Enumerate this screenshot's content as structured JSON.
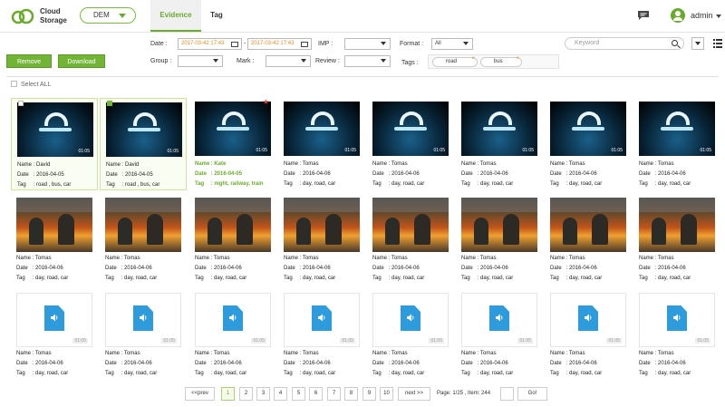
{
  "header": {
    "logo_line1": "Cloud",
    "logo_line2": "Storage",
    "dem_select": "DEM",
    "tabs": [
      {
        "label": "Evidence"
      },
      {
        "label": "Tag"
      }
    ],
    "user": "admin"
  },
  "filters": {
    "date_label": "Date :",
    "date_from": "2017-03-42  17:43",
    "date_to": "2017-03-42  17:43",
    "imp_label": "IMP :",
    "format_label": "Format :",
    "format_value": "All",
    "keyword_placeholder": "Keyword",
    "group_label": "Group :",
    "mark_label": "Mark :",
    "review_label": "Review :",
    "tags_label": "Tags :",
    "tags": [
      "road",
      "bus"
    ]
  },
  "actions": {
    "remove": "Remove",
    "download": "Download",
    "select_all": "Select ALL"
  },
  "labels": {
    "name": "Name",
    "date": "Date",
    "tag": "Tag"
  },
  "cards": [
    {
      "type": "night",
      "duration": "01:05",
      "name": "David",
      "date": "2016-04-05",
      "tag": "road , bus, car",
      "selected": true,
      "checked": false
    },
    {
      "type": "night",
      "duration": "01:05",
      "name": "David",
      "date": "2016-04-05",
      "tag": "road , bus, car",
      "selected": true,
      "checked": true
    },
    {
      "type": "night",
      "duration": "01:05",
      "name": "Kate",
      "date": "2016-04-05",
      "tag": "night, railway, train",
      "highlight": true,
      "starred": true
    },
    {
      "type": "night",
      "duration": "01:05",
      "name": "Tomas",
      "date": "2016-04-06",
      "tag": "day, road, car"
    },
    {
      "type": "night",
      "duration": "01:05",
      "name": "Tomas",
      "date": "2016-04-06",
      "tag": "day, road, car"
    },
    {
      "type": "night",
      "duration": "01:05",
      "name": "Tomas",
      "date": "2016-04-06",
      "tag": "day, road, car"
    },
    {
      "type": "night",
      "duration": "01:05",
      "name": "Tomas",
      "date": "2016-04-06",
      "tag": "day, road, car"
    },
    {
      "type": "night",
      "duration": "01:05",
      "name": "Tomas",
      "date": "2016-04-06",
      "tag": "day, road, car"
    },
    {
      "type": "fire",
      "duration": "",
      "name": "Tomas",
      "date": "2016-04-06",
      "tag": "day, road, car"
    },
    {
      "type": "fire",
      "duration": "",
      "name": "Tomas",
      "date": "2016-04-06",
      "tag": "day, road, car"
    },
    {
      "type": "fire",
      "duration": "",
      "name": "Tomas",
      "date": "2016-04-06",
      "tag": "day, road, car"
    },
    {
      "type": "fire",
      "duration": "",
      "name": "Tomas",
      "date": "2016-04-06",
      "tag": "day, road, car"
    },
    {
      "type": "fire",
      "duration": "",
      "name": "Tomas",
      "date": "2016-04-06",
      "tag": "day, road, car"
    },
    {
      "type": "fire",
      "duration": "",
      "name": "Tomas",
      "date": "2016-04-06",
      "tag": "day, road, car"
    },
    {
      "type": "fire",
      "duration": "",
      "name": "Tomas",
      "date": "2016-04-06",
      "tag": "day, road, car"
    },
    {
      "type": "fire",
      "duration": "",
      "name": "Tomas",
      "date": "2016-04-06",
      "tag": "day, road, car"
    },
    {
      "type": "audio",
      "duration": "01:05",
      "name": "Tomas",
      "date": "2016-04-06",
      "tag": "day, road, car"
    },
    {
      "type": "audio",
      "duration": "01:05",
      "name": "Tomas",
      "date": "2016-04-06",
      "tag": "day, road, car"
    },
    {
      "type": "audio",
      "duration": "01:05",
      "name": "Tomas",
      "date": "2016-04-06",
      "tag": "day, road, car"
    },
    {
      "type": "audio",
      "duration": "01:05",
      "name": "Tomas",
      "date": "2016-04-06",
      "tag": "day, road, car"
    },
    {
      "type": "audio",
      "duration": "01:05",
      "name": "Tomas",
      "date": "2016-04-06",
      "tag": "day, road, car"
    },
    {
      "type": "audio",
      "duration": "01:05",
      "name": "Tomas",
      "date": "2016-04-06",
      "tag": "day, road, car"
    },
    {
      "type": "audio",
      "duration": "01:05",
      "name": "Tomas",
      "date": "2016-04-06",
      "tag": "day, road, car"
    },
    {
      "type": "audio",
      "duration": "01:05",
      "name": "Tomas",
      "date": "2016-04-06",
      "tag": "day, road, car"
    }
  ],
  "pagination": {
    "prev": "<<prev",
    "pages": [
      "1",
      "2",
      "3",
      "4",
      "5",
      "6",
      "7",
      "8",
      "9",
      "10"
    ],
    "active": "1",
    "next": "next >>",
    "info": "Page: 1/25 , Item: 244",
    "go": "Go!"
  },
  "colors": {
    "accent": "#72b536",
    "highlight": "#6aaa2c",
    "date_orange": "#e68a1d",
    "audio_blue": "#2e9bdd"
  }
}
